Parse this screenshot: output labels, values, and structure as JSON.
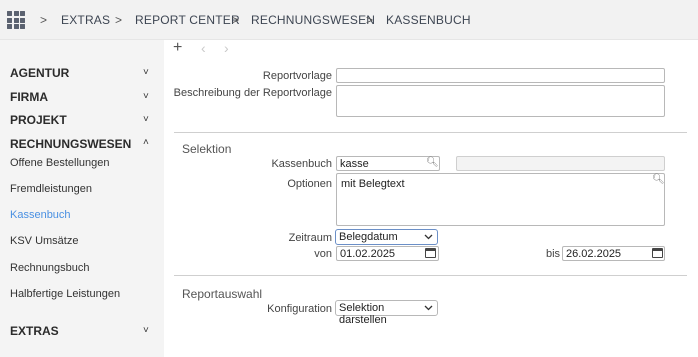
{
  "breadcrumb": {
    "items": [
      "EXTRAS",
      "REPORT CENTER",
      "RECHNUNGSWESEN",
      "KASSENBUCH"
    ],
    "separator": ">"
  },
  "sidebar": {
    "sections": [
      {
        "label": "AGENTUR",
        "chevron": "˅"
      },
      {
        "label": "FIRMA",
        "chevron": "˅"
      },
      {
        "label": "PROJEKT",
        "chevron": "˅"
      },
      {
        "label": "RECHNUNGSWESEN",
        "chevron": "˄"
      },
      {
        "label": "EXTRAS",
        "chevron": "˅"
      }
    ],
    "items": [
      {
        "label": "Offene Bestellungen"
      },
      {
        "label": "Fremdleistungen"
      },
      {
        "label": "Kassenbuch",
        "active": true
      },
      {
        "label": "KSV Umsätze"
      },
      {
        "label": "Rechnungsbuch"
      },
      {
        "label": "Halbfertige Leistungen"
      }
    ],
    "active_color": "#4a90e2"
  },
  "toolbar": {
    "add": "+",
    "prev": "‹",
    "next": "›"
  },
  "form": {
    "reportvorlage_label": "Reportvorlage",
    "reportvorlage_value": "",
    "beschreibung_label": "Beschreibung der Reportvorlage",
    "beschreibung_value": "",
    "selektion_title": "Selektion",
    "kassenbuch_label": "Kassenbuch",
    "kassenbuch_value": "kasse",
    "kassenbuch_desc": "",
    "optionen_label": "Optionen",
    "optionen_value": "mit Belegtext",
    "zeitraum_label": "Zeitraum",
    "zeitraum_value": "Belegdatum",
    "von_label": "von",
    "von_value": "01.02.2025",
    "bis_label": "bis",
    "bis_value": "26.02.2025",
    "reportauswahl_title": "Reportauswahl",
    "konfiguration_label": "Konfiguration",
    "konfiguration_value": "Selektion darstellen"
  },
  "icons": {
    "apps": "grid-icon",
    "search": "search-icon",
    "calendar": "calendar-icon",
    "dropdown": "chevron-down-icon"
  }
}
